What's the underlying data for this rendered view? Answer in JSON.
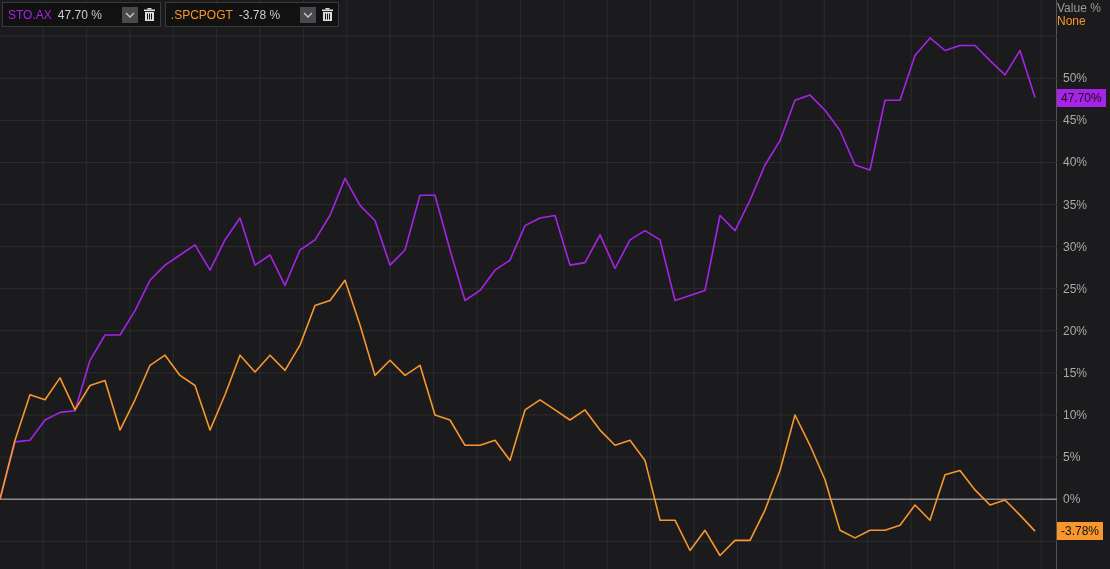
{
  "legend": [
    {
      "value": "47.70 %"
    },
    {
      "value": "-3.78 %"
    }
  ],
  "axis": {
    "title": "Value %",
    "mode": "None"
  },
  "chart": {
    "chart_data": {
      "type": "line",
      "grid": true,
      "ylim": [
        -8.3,
        59.3
      ],
      "yticks": [
        {
          "value": 0,
          "label": "0%"
        },
        {
          "value": 5,
          "label": "5%"
        },
        {
          "value": 10,
          "label": "10%"
        },
        {
          "value": 15,
          "label": "15%"
        },
        {
          "value": 20,
          "label": "20%"
        },
        {
          "value": 25,
          "label": "25%"
        },
        {
          "value": 30,
          "label": "30%"
        },
        {
          "value": 35,
          "label": "35%"
        },
        {
          "value": 40,
          "label": "40%"
        },
        {
          "value": 45,
          "label": "45%"
        },
        {
          "value": 50,
          "label": "50%"
        }
      ],
      "series": [
        {
          "name": "STO.AX",
          "color": "#a822e8",
          "values": [
            0,
            6.8,
            7.0,
            9.4,
            10.3,
            10.5,
            16.5,
            19.5,
            19.5,
            22.4,
            26.0,
            27.8,
            29.0,
            30.2,
            27.2,
            30.8,
            33.4,
            27.8,
            29.0,
            25.4,
            29.6,
            30.8,
            33.7,
            38.1,
            34.9,
            33.1,
            27.8,
            29.6,
            36.1,
            36.1,
            29.6,
            23.6,
            24.8,
            27.2,
            28.4,
            32.5,
            33.4,
            33.7,
            27.8,
            28.1,
            31.4,
            27.4,
            30.8,
            31.9,
            30.8,
            23.6,
            24.2,
            24.8,
            33.7,
            31.9,
            35.5,
            39.7,
            42.6,
            47.4,
            48.0,
            46.2,
            43.8,
            39.7,
            39.1,
            47.4,
            47.4,
            52.7,
            54.8,
            53.3,
            53.9,
            53.9,
            52.1,
            50.4,
            53.3,
            47.7
          ]
        },
        {
          "name": ".SPCPOGT",
          "color": "#f7962c",
          "values": [
            0,
            7.0,
            12.4,
            11.8,
            14.4,
            10.6,
            13.5,
            14.1,
            8.2,
            11.8,
            15.9,
            17.1,
            14.7,
            13.5,
            8.2,
            12.4,
            17.1,
            15.1,
            17.1,
            15.3,
            18.3,
            23.0,
            23.6,
            26.0,
            20.7,
            14.7,
            16.5,
            14.7,
            15.9,
            10.0,
            9.4,
            6.4,
            6.4,
            7.0,
            4.6,
            10.6,
            11.8,
            10.6,
            9.4,
            10.6,
            8.2,
            6.4,
            7.0,
            4.6,
            -2.5,
            -2.5,
            -6.1,
            -3.7,
            -6.7,
            -4.9,
            -4.9,
            -1.3,
            3.4,
            10.0,
            6.4,
            2.3,
            -3.7,
            -4.6,
            -3.7,
            -3.7,
            -3.1,
            -0.7,
            -2.5,
            2.9,
            3.4,
            1.1,
            -0.7,
            -0.1,
            -1.9,
            -3.8
          ]
        }
      ]
    },
    "value_tags": [
      "47.70%",
      "-3.78%"
    ]
  }
}
